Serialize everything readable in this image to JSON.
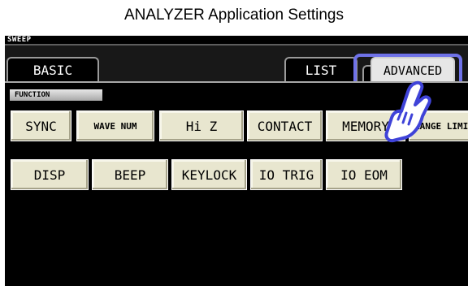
{
  "window": {
    "title": "ANALYZER Application Settings"
  },
  "screen": {
    "mode_label": "SWEEP",
    "tabs": [
      {
        "label": "BASIC"
      },
      {
        "label": "LIST"
      },
      {
        "label": "ADVANCED",
        "selected": true
      }
    ],
    "section_label": "FUNCTION",
    "buttons_row1": [
      {
        "label": "SYNC"
      },
      {
        "label": "WAVE NUM"
      },
      {
        "label": "Hi Z"
      },
      {
        "label": "CONTACT"
      },
      {
        "label": "MEMORY"
      },
      {
        "label": "RANGE LIMIT"
      }
    ],
    "buttons_row2": [
      {
        "label": "DISP"
      },
      {
        "label": "BEEP"
      },
      {
        "label": "KEYLOCK"
      },
      {
        "label": "IO TRIG"
      },
      {
        "label": "IO EOM"
      }
    ]
  },
  "colors": {
    "highlight": "#6f72e8",
    "button_face": "#e8e6cf",
    "screen_bg": "#000000"
  },
  "icons": {
    "pointer": "tap-hand-icon"
  }
}
